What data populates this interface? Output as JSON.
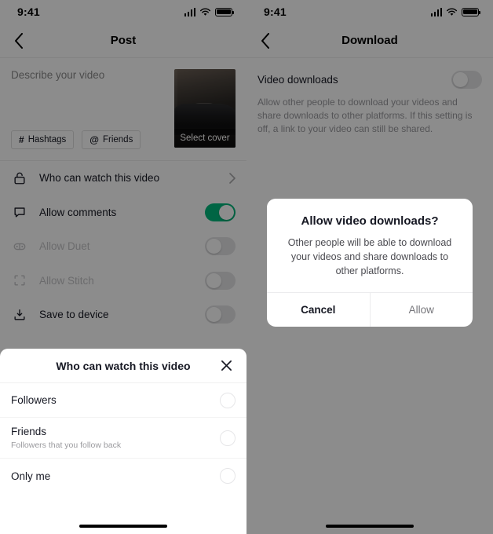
{
  "left": {
    "status_bar": {
      "time": "9:41",
      "signal_icon": "cellular-bars-icon",
      "wifi_icon": "wifi-icon",
      "battery_icon": "battery-icon"
    },
    "nav": {
      "back_icon": "chevron-left-icon",
      "title": "Post"
    },
    "composer": {
      "description_placeholder": "Describe your video",
      "chips": [
        {
          "symbol": "#",
          "label": "Hashtags",
          "icon": "hashtag-icon"
        },
        {
          "symbol": "@",
          "label": "Friends",
          "icon": "at-mention-icon"
        }
      ],
      "cover": {
        "label": "Select cover",
        "icon": "video-cover-thumbnail"
      }
    },
    "settings_rows": [
      {
        "icon": "unlock-icon",
        "label": "Who can watch this video",
        "control": "chevron",
        "disabled": false
      },
      {
        "icon": "comment-bubble-icon",
        "label": "Allow comments",
        "control": "toggle",
        "toggle_on": true,
        "disabled": false
      },
      {
        "icon": "duet-icon",
        "label": "Allow Duet",
        "control": "toggle",
        "toggle_on": false,
        "disabled": true
      },
      {
        "icon": "stitch-icon",
        "label": "Allow Stitch",
        "control": "toggle",
        "toggle_on": false,
        "disabled": true
      },
      {
        "icon": "download-tray-icon",
        "label": "Save to device",
        "control": "toggle",
        "toggle_on": false,
        "disabled": false
      }
    ],
    "sheet": {
      "title": "Who can watch this video",
      "close_icon": "close-x-icon",
      "options": [
        {
          "title": "Followers",
          "subtitle": "",
          "selected": false
        },
        {
          "title": "Friends",
          "subtitle": "Followers that you follow back",
          "selected": false
        },
        {
          "title": "Only me",
          "subtitle": "",
          "selected": false
        }
      ]
    },
    "home_indicator": "home-indicator"
  },
  "right": {
    "status_bar": {
      "time": "9:41",
      "signal_icon": "cellular-bars-icon",
      "wifi_icon": "wifi-icon",
      "battery_icon": "battery-icon"
    },
    "nav": {
      "back_icon": "chevron-left-icon",
      "title": "Download"
    },
    "download": {
      "title": "Video downloads",
      "toggle_on": false,
      "description": "Allow other people to download your videos and share downloads to other platforms. If this setting is off, a link to your video can still be shared."
    },
    "alert": {
      "title": "Allow video downloads?",
      "message": "Other people will be able to download your videos and share downloads to other platforms.",
      "cancel_label": "Cancel",
      "confirm_label": "Allow"
    },
    "home_indicator": "home-indicator"
  },
  "colors": {
    "accent_green": "#00b87c",
    "text_primary": "#161823",
    "text_secondary": "#9a9a9e",
    "toggle_off": "#e3e3e5",
    "overlay": "rgba(0,0,0,0.45)"
  }
}
